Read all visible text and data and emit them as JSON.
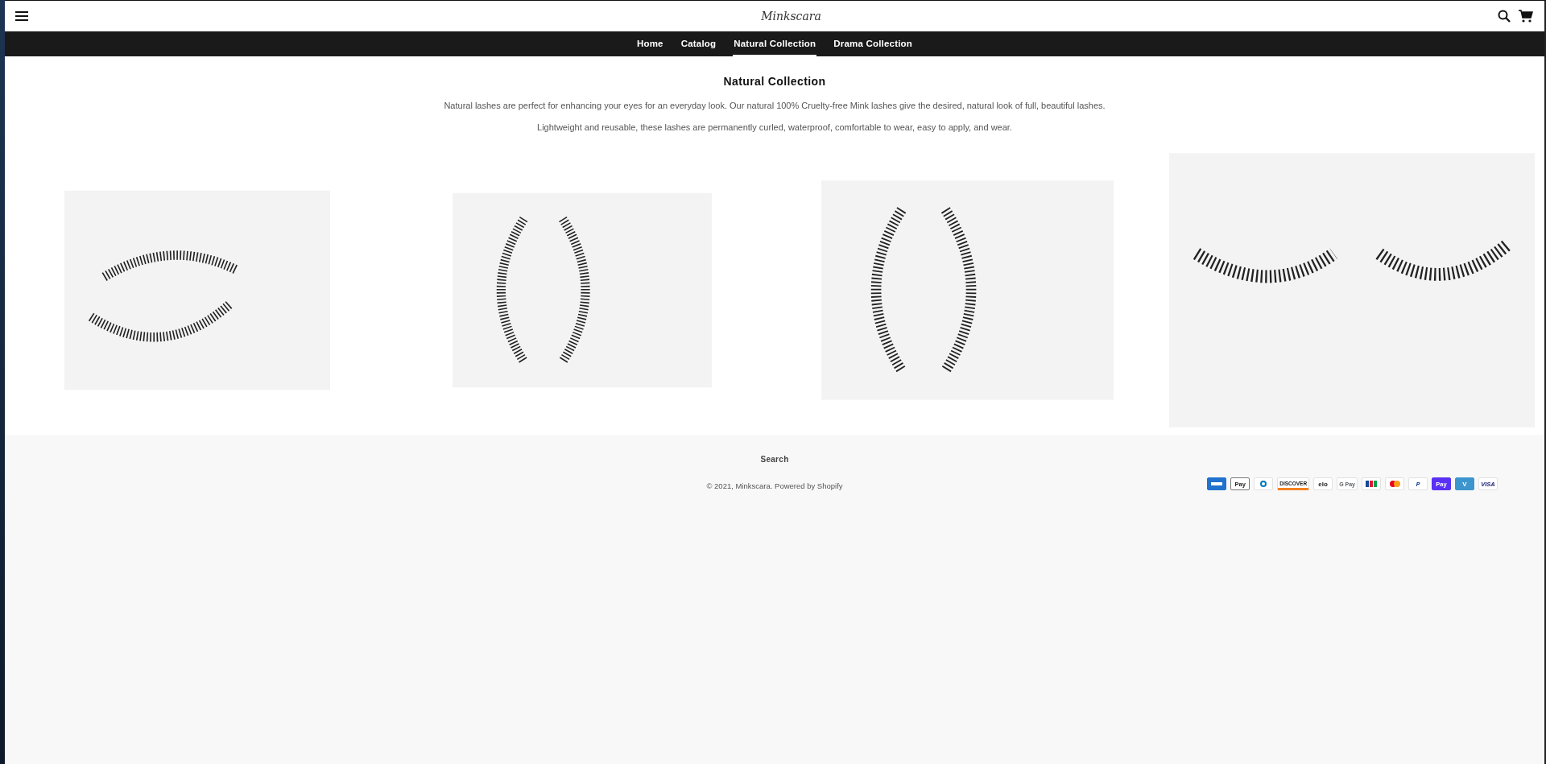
{
  "header": {
    "logo": "Minkscara"
  },
  "nav": [
    {
      "label": "Home",
      "selected": false
    },
    {
      "label": "Catalog",
      "selected": false
    },
    {
      "label": "Natural Collection",
      "selected": true
    },
    {
      "label": "Drama Collection",
      "selected": false
    }
  ],
  "collection": {
    "title": "Natural Collection",
    "paragraphs": [
      "Natural lashes are perfect for enhancing your eyes for an everyday look. Our natural  100% Cruelty-free Mink lashes give the desired, natural look of full, beautiful lashes.",
      "Lightweight and reusable, these lashes are permanently curled, waterproof, comfortable to wear, easy to apply, and wear."
    ]
  },
  "products": [
    {
      "kind": "stacked"
    },
    {
      "kind": "facing"
    },
    {
      "kind": "facing"
    },
    {
      "kind": "side"
    }
  ],
  "footer": {
    "link": "Search",
    "copyright": "© 2021, Minkscara. Powered by Shopify",
    "payments": [
      {
        "kind": "amex"
      },
      {
        "kind": "applepay",
        "label": "Pay"
      },
      {
        "kind": "diners"
      },
      {
        "kind": "discover",
        "label": "DISCOVER"
      },
      {
        "kind": "elo",
        "label": "elo"
      },
      {
        "kind": "gpay",
        "label": "G Pay"
      },
      {
        "kind": "jcb"
      },
      {
        "kind": "mastercard"
      },
      {
        "kind": "paypal",
        "label": "P"
      },
      {
        "kind": "shoppay",
        "label": "Pay"
      },
      {
        "kind": "venmo",
        "label": "V"
      },
      {
        "kind": "visa",
        "label": "VISA"
      }
    ]
  }
}
